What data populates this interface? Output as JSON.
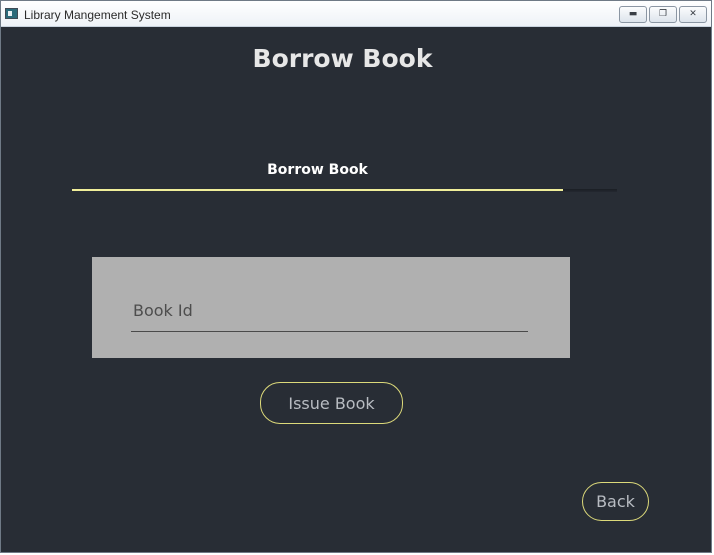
{
  "window": {
    "title": "Library Mangement System",
    "controls": {
      "minimize_icon": "minimize-icon",
      "maximize_icon": "restore-icon",
      "close_icon": "close-icon"
    }
  },
  "page": {
    "title": "Borrow Book"
  },
  "tabs": [
    {
      "label": "Borrow Book",
      "selected": true
    }
  ],
  "form": {
    "book_id": {
      "placeholder": "Book Id",
      "value": ""
    }
  },
  "actions": {
    "issue_label": "Issue Book",
    "back_label": "Back"
  },
  "colors": {
    "background": "#282d35",
    "accent": "#f0ee9a",
    "card": "#b0b0b0",
    "title_text": "#e7e7e7"
  }
}
